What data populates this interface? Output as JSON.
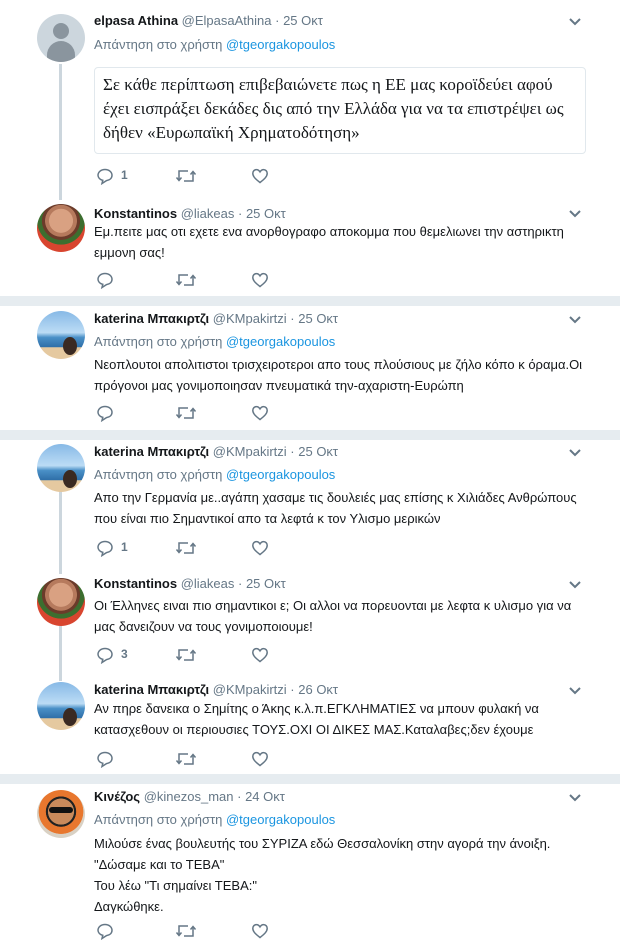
{
  "icons": {
    "reply": "reply-icon",
    "retweet": "retweet-icon",
    "like": "heart-icon",
    "caret": "chevron-down-icon"
  },
  "colors": {
    "link": "#1b95e0",
    "muted": "#657786",
    "text": "#14171a",
    "divider": "#e6ecf0",
    "thread_line": "#ccd6dd"
  },
  "tweets": [
    {
      "name": "elpasa Athina",
      "handle": "@ElpasaAthina",
      "dot": "·",
      "date": "25 Οκτ",
      "reply_label": "Απάντηση στο χρήστη",
      "reply_handle": "@tgeorgakopoulos",
      "card_text": "Σε κάθε περίπτωση επιβεβαιώνετε πως η ΕΕ μας κοροϊδεύει αφού έχει εισπράξει δεκάδες δις από την Ελλάδα για να τα επιστρέψει ως δήθεν «Ευρωπαϊκή Χρηματοδότηση»",
      "reply_count": "1"
    },
    {
      "name": "Konstantinos",
      "handle": "@liakeas",
      "dot": "·",
      "date": "25 Οκτ",
      "text": "Εμ.πειτε μας οτι εχετε ενα ανορθογραφο αποκομμα που θεμελιωνει την αστηρικτη εμμονη σας!"
    },
    {
      "name": "katerina Μπακιρτζι",
      "handle": "@KMpakirtzi",
      "dot": "·",
      "date": "25 Οκτ",
      "reply_label": "Απάντηση στο χρήστη",
      "reply_handle": "@tgeorgakopoulos",
      "text": "Νεοπλουτοι απολιτιστοι τρισχειροτεροι απο τους πλούσιους με ζήλο κόπο κ όραμα.Οι πρόγονοι μας γονιμοποιησαν πνευματικά την-αχαριστη-Ευρώπη"
    },
    {
      "name": "katerina Μπακιρτζι",
      "handle": "@KMpakirtzi",
      "dot": "·",
      "date": "25 Οκτ",
      "reply_label": "Απάντηση στο χρήστη",
      "reply_handle": "@tgeorgakopoulos",
      "text": "Απο την Γερμανία με..αγάπη χασαμε τις δουλειές μας επίσης κ Χιλιάδες Ανθρώπους που είναι πιο Σημαντικοί απο τα λεφτά κ τον Υλισμο μερικών",
      "reply_count": "1"
    },
    {
      "name": "Konstantinos",
      "handle": "@liakeas",
      "dot": "·",
      "date": "25 Οκτ",
      "text": "Οι Έλληνες ειναι πιο σημαντικοι ε; Οι αλλοι να πορευονται με λεφτα κ υλισμο για να μας δανειζουν να τους γονιμοποιουμε!",
      "reply_count": "3"
    },
    {
      "name": "katerina Μπακιρτζι",
      "handle": "@KMpakirtzi",
      "dot": "·",
      "date": "26 Οκτ",
      "text": "Αν πηρε δανεικα ο Σημίτης ο Άκης κ.λ.π.ΕΓΚΛΗΜΑΤΙΕΣ να μπουν φυλακή να κατασχεθουν οι περιουσιες ΤΟΥΣ.ΟΧΙ ΟΙ ΔΙΚΕΣ ΜΑΣ.Καταλαβες;δεν έχουμε"
    },
    {
      "name": "Κινέζος",
      "handle": "@kinezos_man",
      "dot": "·",
      "date": "24 Οκτ",
      "reply_label": "Απάντηση στο χρήστη",
      "reply_handle": "@tgeorgakopoulos",
      "lines": [
        "Μιλούσε ένας βουλευτής του ΣΥΡΙΖΑ εδώ Θεσσαλονίκη στην αγορά την άνοιξη.",
        "\"Δώσαμε και το ΤΕΒΑ\"",
        "Του λέω \"Τι σημαίνει ΤΕΒΑ:\"",
        "Δαγκώθηκε."
      ]
    }
  ]
}
